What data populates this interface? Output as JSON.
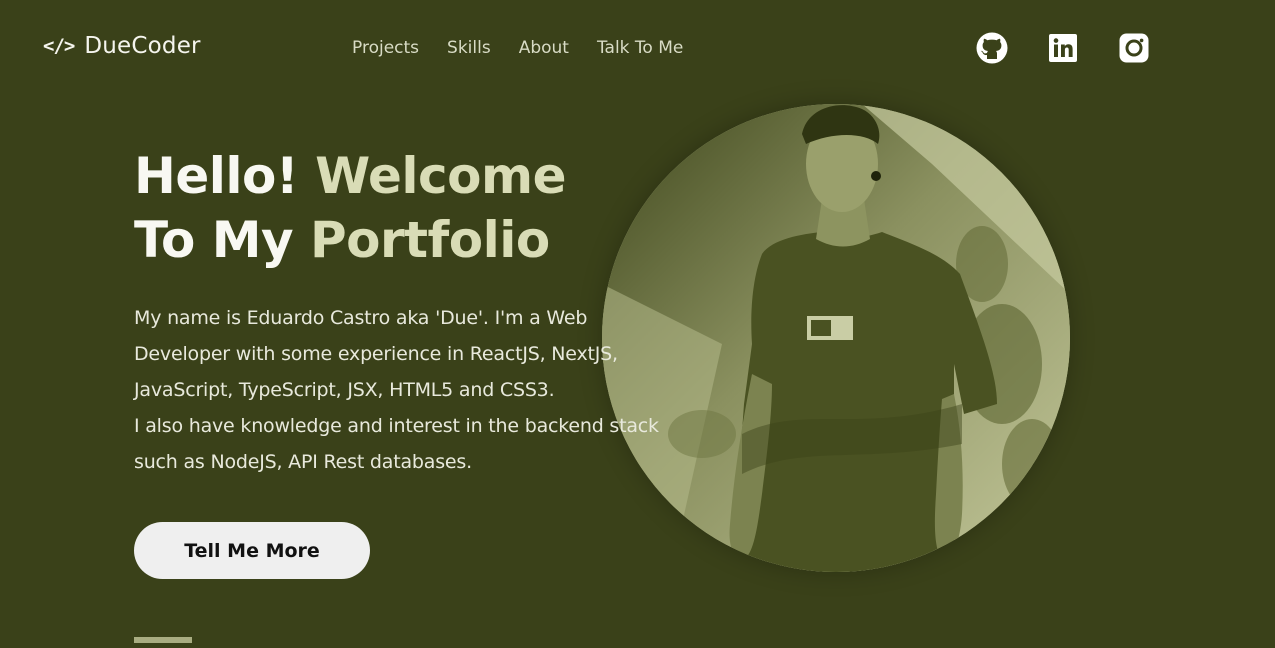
{
  "header": {
    "logo_mark": "</>",
    "logo_text": "DueCoder",
    "nav": [
      "Projects",
      "Skills",
      "About",
      "Talk To Me"
    ]
  },
  "social": [
    {
      "icon": "github-icon"
    },
    {
      "icon": "linkedin-icon"
    },
    {
      "icon": "instagram-icon"
    }
  ],
  "hero": {
    "title_white_1": "Hello! ",
    "title_accent_1": "Welcome",
    "title_white_2": "To My ",
    "title_accent_2": "Portfolio",
    "bio_line_1": "My name is Eduardo Castro aka 'Due'. I'm a Web",
    "bio_line_2": "Developer with some experience in ReactJS, NextJS,",
    "bio_line_3": "JavaScript, TypeScript, JSX, HTML5 and CSS3.",
    "bio_line_4": "I also have knowledge and interest in the backend stack",
    "bio_line_5": "such as NodeJS, API Rest databases.",
    "cta_label": "Tell Me More"
  },
  "colors": {
    "background": "#3a4119",
    "accent_text": "#d9dcb6",
    "button_bg": "#efefef"
  }
}
